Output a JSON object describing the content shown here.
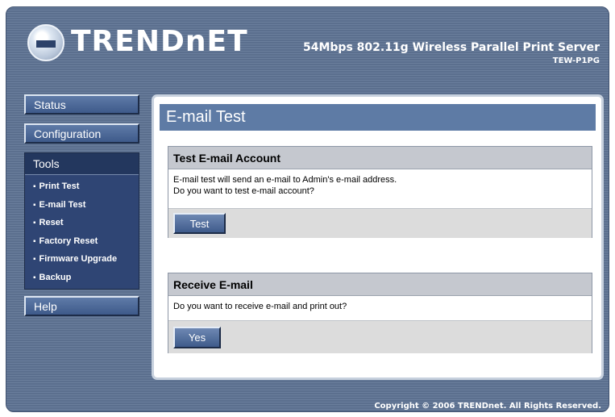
{
  "header": {
    "logo_text": "TRENDnET",
    "product_title": "54Mbps 802.11g Wireless Parallel Print Server",
    "model": "TEW-P1PG"
  },
  "sidebar": {
    "status": "Status",
    "configuration": "Configuration",
    "tools": {
      "label": "Tools",
      "items": [
        "Print Test",
        "E-mail Test",
        "Reset",
        "Factory Reset",
        "Firmware Upgrade",
        "Backup"
      ]
    },
    "help": "Help"
  },
  "main": {
    "title": "E-mail Test",
    "test_account": {
      "heading": "Test E-mail Account",
      "line1": "E-mail test will send an e-mail to Admin's e-mail address.",
      "line2": "Do you want to test e-mail account?",
      "button": "Test"
    },
    "receive": {
      "heading": "Receive E-mail",
      "line1": "Do you want to receive e-mail and print out?",
      "button": "Yes"
    }
  },
  "footer": {
    "copyright": "Copyright © 2006 TRENDnet. All Rights Reserved."
  },
  "colors": {
    "frame": "#5b6f8e",
    "panel_title": "#5e7ba5",
    "section_head": "#c5c8cf",
    "tools_box": "#2f4574"
  },
  "icons": {
    "logo": "trendnet-logo-icon"
  }
}
